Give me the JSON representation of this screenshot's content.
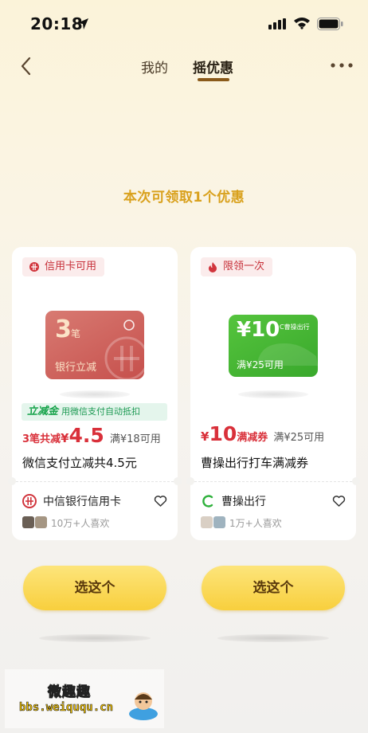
{
  "status_bar": {
    "time": "20:18"
  },
  "nav": {
    "tabs": [
      "我的",
      "摇优惠"
    ],
    "active_tab": "摇优惠"
  },
  "headline": "本次可领取1个优惠",
  "cards": [
    {
      "tag": "信用卡可用",
      "visual": {
        "big": "3",
        "unit": "笔",
        "caption": "银行立减"
      },
      "wx_strip": {
        "brand": "立减金",
        "text": "用微信支付自动抵扣"
      },
      "price": {
        "prefix": "3笔共减",
        "symbol": "¥",
        "amount": "4.5",
        "condition": "满¥18可用"
      },
      "title": "微信支付立减共4.5元",
      "merchant": "中信银行信用卡",
      "likes": "10万+人喜欢"
    },
    {
      "tag": "限领一次",
      "visual": {
        "big": "¥10",
        "brand": "曹操出行",
        "caption": "满¥25可用"
      },
      "price": {
        "symbol": "¥",
        "amount": "10",
        "type": "满减券",
        "condition": "满¥25可用"
      },
      "title": "曹操出行打车满减券",
      "merchant": "曹操出行",
      "likes": "1万+人喜欢"
    }
  ],
  "buttons": {
    "select_left": "选这个",
    "select_right": "选这个"
  },
  "watermark": {
    "title": "微趣趣",
    "url": "bbs.weiququ.cn"
  },
  "colors": {
    "accent_yellow": "#f8cf3d",
    "price_red": "#d9303a",
    "headline_gold": "#d9a11d",
    "tab_active_underline": "#8a5a1a"
  },
  "icons": [
    "location-arrow-icon",
    "signal-icon",
    "wifi-icon",
    "battery-icon",
    "back-chevron-icon",
    "more-dots-icon",
    "citic-bank-icon",
    "flame-icon",
    "heart-icon",
    "caocao-logo-icon"
  ]
}
